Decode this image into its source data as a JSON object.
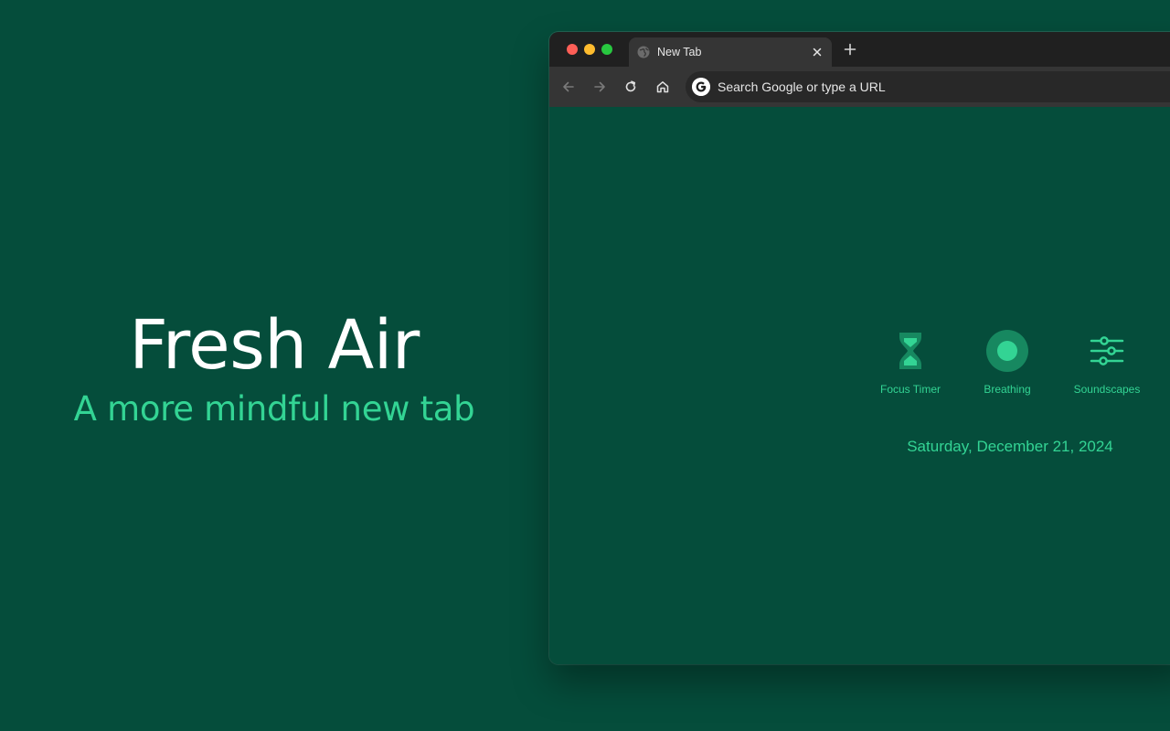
{
  "hero": {
    "title": "Fresh Air",
    "subtitle": "A more mindful new tab"
  },
  "browser": {
    "tab": {
      "title": "New Tab",
      "icon": "globe-icon"
    },
    "toolbar": {
      "omnibox_placeholder": "Search Google or type a URL"
    }
  },
  "newtab": {
    "tools": [
      {
        "label": "Focus Timer",
        "icon": "hourglass-icon"
      },
      {
        "label": "Breathing",
        "icon": "breathing-circle-icon"
      },
      {
        "label": "Soundscapes",
        "icon": "sliders-icon"
      }
    ],
    "date": "Saturday, December 21, 2024"
  },
  "colors": {
    "background": "#054d3b",
    "accent": "#33d494",
    "titlebar": "#202020",
    "toolbar": "#353535"
  }
}
